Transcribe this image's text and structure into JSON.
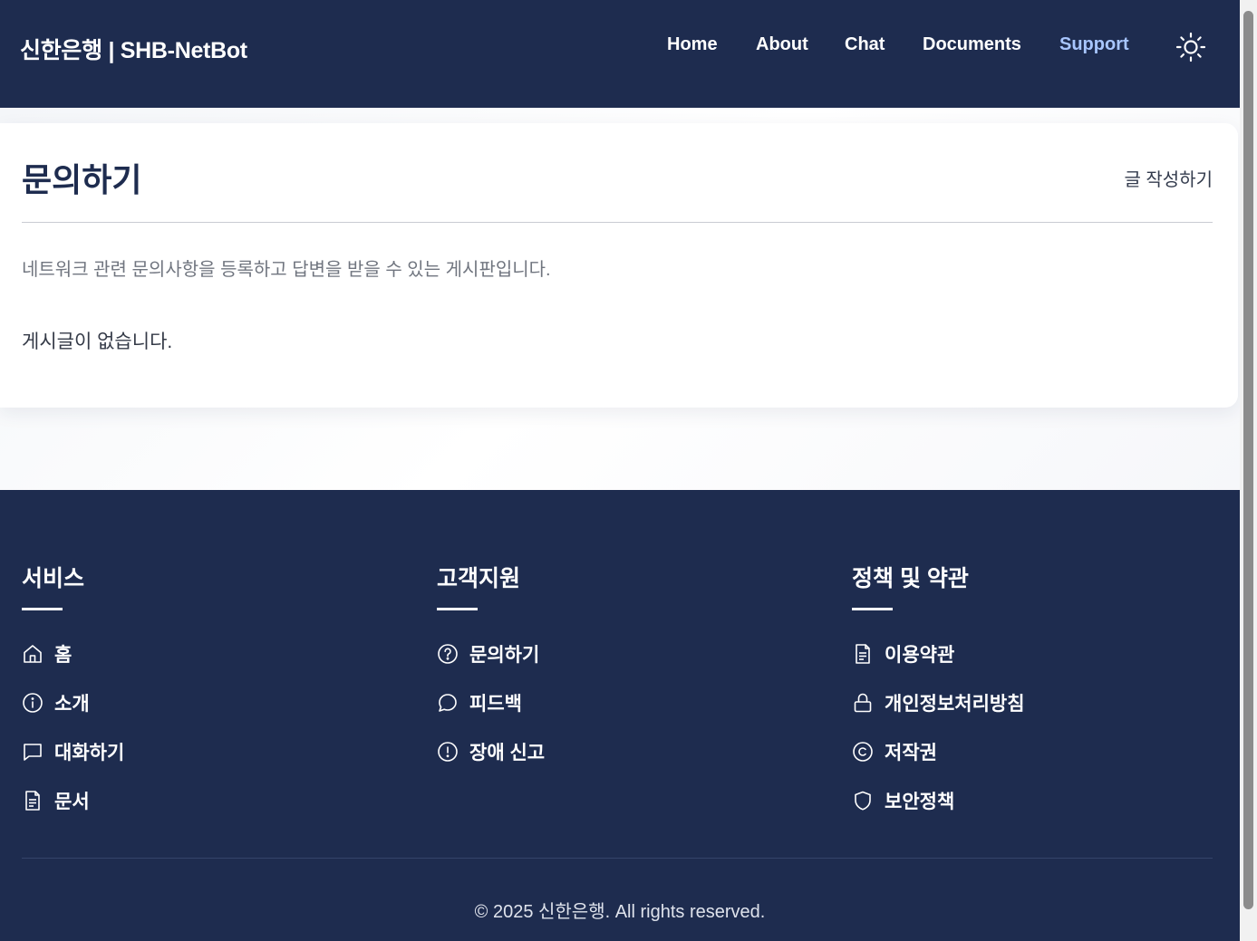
{
  "header": {
    "brand": "신한은행 | SHB-NetBot",
    "nav": [
      {
        "label": "Home",
        "active": false
      },
      {
        "label": "About",
        "active": false
      },
      {
        "label": "Chat",
        "active": false
      },
      {
        "label": "Documents",
        "active": false
      },
      {
        "label": "Support",
        "active": true
      }
    ],
    "theme_icon": "sun-icon",
    "active_color": "#a8c6ff"
  },
  "board": {
    "title": "문의하기",
    "write_label": "글 작성하기",
    "description": "네트워크 관련 문의사항을 등록하고 답변을 받을 수 있는 게시판입니다.",
    "empty_message": "게시글이 없습니다."
  },
  "footer": {
    "columns": [
      {
        "heading": "서비스",
        "items": [
          {
            "icon": "home-icon",
            "label": "홈"
          },
          {
            "icon": "info-icon",
            "label": "소개"
          },
          {
            "icon": "chat-bubble-icon",
            "label": "대화하기"
          },
          {
            "icon": "document-icon",
            "label": "문서"
          }
        ]
      },
      {
        "heading": "고객지원",
        "items": [
          {
            "icon": "question-circle-icon",
            "label": "문의하기"
          },
          {
            "icon": "message-circle-icon",
            "label": "피드백"
          },
          {
            "icon": "alert-circle-icon",
            "label": "장애 신고"
          }
        ]
      },
      {
        "heading": "정책 및 약관",
        "items": [
          {
            "icon": "document-icon",
            "label": "이용약관"
          },
          {
            "icon": "lock-icon",
            "label": "개인정보처리방침"
          },
          {
            "icon": "copyright-icon",
            "label": "저작권"
          },
          {
            "icon": "shield-icon",
            "label": "보안정책"
          }
        ]
      }
    ],
    "copyright": "© 2025 신한은행. All rights reserved."
  },
  "colors": {
    "navy": "#1e2c4f",
    "white": "#ffffff"
  }
}
